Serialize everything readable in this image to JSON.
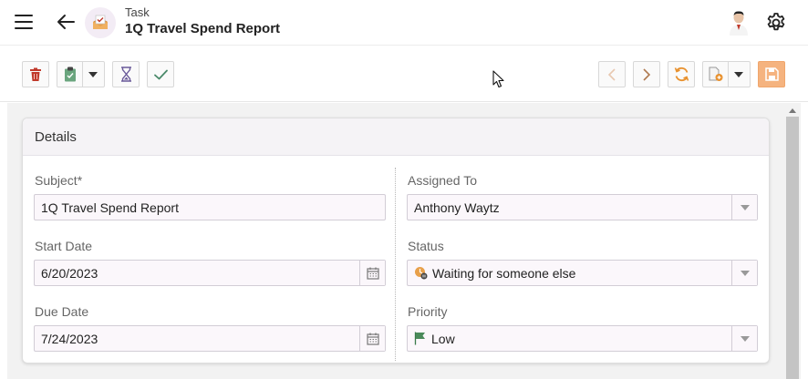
{
  "header": {
    "subtitle": "Task",
    "title": "1Q Travel Spend Report"
  },
  "toolbar": {
    "buttons": [
      "delete-icon",
      "clipboard-icon",
      "hourglass-icon",
      "checkmark-icon",
      "previous-icon",
      "next-icon",
      "refresh-icon",
      "new-document-icon",
      "save-icon"
    ]
  },
  "details": {
    "section_title": "Details",
    "subject": {
      "label": "Subject*",
      "value": "1Q Travel Spend Report"
    },
    "start_date": {
      "label": "Start Date",
      "value": "6/20/2023"
    },
    "due_date": {
      "label": "Due Date",
      "value": "7/24/2023"
    },
    "assigned_to": {
      "label": "Assigned To",
      "value": "Anthony Waytz"
    },
    "status": {
      "label": "Status",
      "value": "Waiting for someone else"
    },
    "priority": {
      "label": "Priority",
      "value": "Low"
    }
  },
  "colors": {
    "accent": "#f5b37f",
    "delete": "#c0392b",
    "task": "#e8a04a",
    "check": "#4a8a6a",
    "hourglass": "#6a5a9a",
    "flag": "#4a8a5a"
  }
}
